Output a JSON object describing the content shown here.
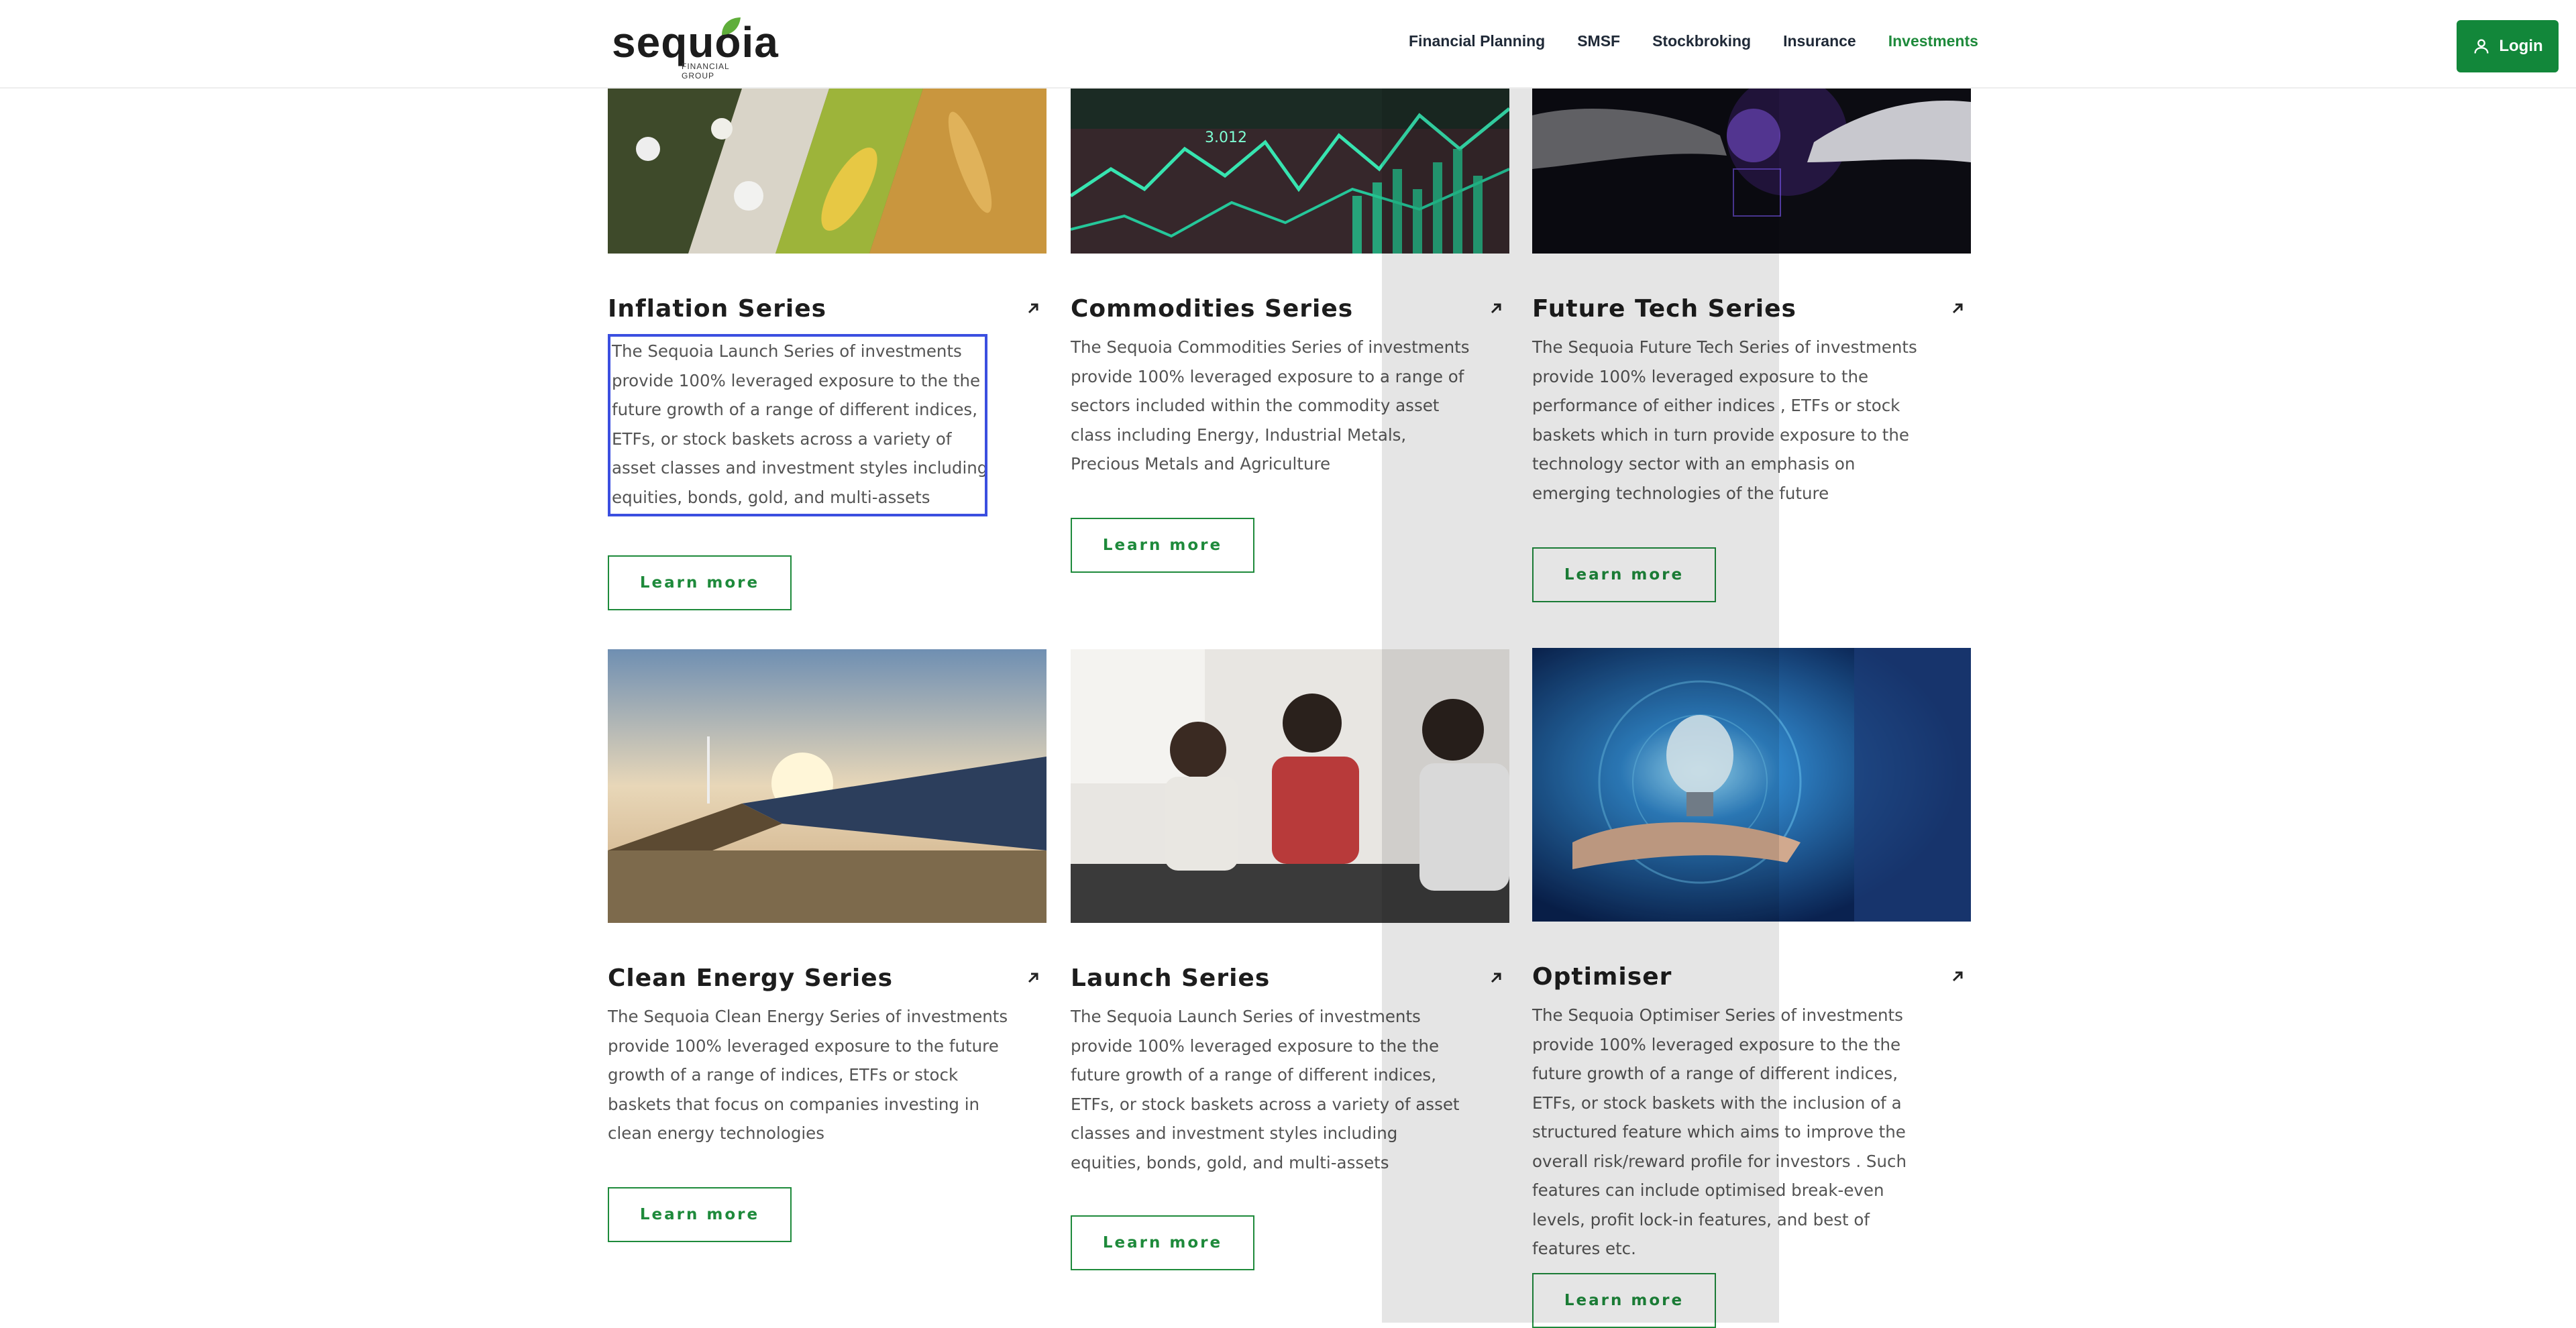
{
  "header": {
    "logo_text": "sequoia",
    "logo_subtext": "FINANCIAL GROUP",
    "nav": [
      {
        "label": "Financial Planning"
      },
      {
        "label": "SMSF"
      },
      {
        "label": "Stockbroking"
      },
      {
        "label": "Insurance"
      },
      {
        "label": "Investments"
      }
    ],
    "login_label": "Login",
    "active_nav": "Investments"
  },
  "colors": {
    "accent": "#1e8a3b",
    "focus": "#3b4fe0"
  },
  "cards": [
    {
      "title": "Inflation Series",
      "description": "The Sequoia Launch Series of investments provide 100% leveraged exposure to the the future growth of a range of different indices, ETFs, or stock baskets across a variety of asset classes and investment styles including equities, bonds, gold, and multi-assets",
      "button": "Learn more",
      "image": "crops-image"
    },
    {
      "title": "Commodities Series",
      "description": "The Sequoia Commodities Series of investments provide 100% leveraged exposure to a range of sectors included within the commodity asset class including Energy, Industrial Metals, Precious Metals and Agriculture",
      "button": "Learn more",
      "image": "stock-chart-image",
      "image_text": "3.012"
    },
    {
      "title": "Future Tech Series",
      "description": "The Sequoia Future Tech Series of investments provide 100% leveraged exposure to the performance of either indices , ETFs or stock baskets which in turn provide exposure to the technology sector with an emphasis on emerging technologies of the future",
      "button": "Learn more",
      "image": "robot-hand-image"
    },
    {
      "title": "Clean Energy Series",
      "description": "The Sequoia Clean Energy Series of investments provide 100% leveraged exposure to the future growth of a range of indices, ETFs or stock baskets that focus on companies investing in clean energy technologies",
      "button": "Learn more",
      "image": "solar-panels-image"
    },
    {
      "title": "Launch Series",
      "description": "The Sequoia Launch Series of investments provide 100% leveraged exposure to the the future growth of a range of different indices, ETFs, or stock baskets across a variety of asset classes and investment styles including equities, bonds, gold, and multi-assets",
      "button": "Learn more",
      "image": "meeting-image"
    },
    {
      "title": "Optimiser",
      "description": "The Sequoia Optimiser Series of investments provide 100% leveraged exposure to the the future growth of a range of different indices, ETFs, or stock baskets with the inclusion of a structured feature which aims to improve the overall risk/reward profile for investors . Such features can include optimised break-even levels, profit lock-in features, and best of features etc.",
      "button": "Learn more",
      "image": "lightbulb-hand-image"
    }
  ]
}
